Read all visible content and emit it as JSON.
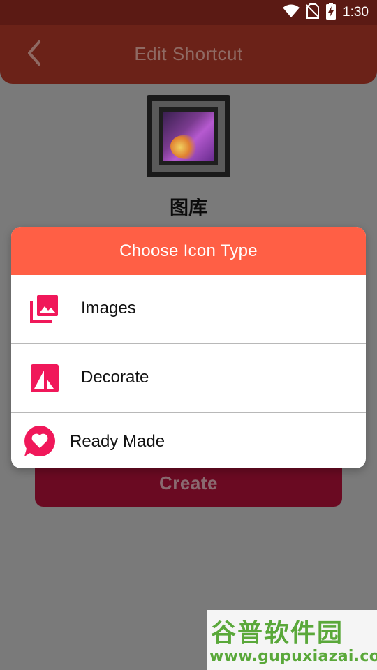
{
  "status_bar": {
    "time": "1:30",
    "icons": [
      "wifi-icon",
      "no-sim-icon",
      "battery-charging-icon"
    ]
  },
  "app_bar": {
    "title": "Edit Shortcut",
    "back_icon": "chevron-left-icon"
  },
  "shortcut": {
    "name": "图库",
    "icon": "gallery-picture-icon"
  },
  "create_button": {
    "label": "Create"
  },
  "dialog": {
    "title": "Choose Icon Type",
    "options": [
      {
        "label": "Images",
        "icon": "photo-library-icon"
      },
      {
        "label": "Decorate",
        "icon": "decorate-icon"
      },
      {
        "label": "Ready Made",
        "icon": "heart-chat-icon"
      }
    ]
  },
  "watermark": {
    "title": "谷普软件园",
    "url": "www.gupuxiazai.com"
  },
  "colors": {
    "status_bar": "#5b1a14",
    "app_bar": "#6b2218",
    "dialog_header": "#ff5f45",
    "icon_accent": "#f0185a",
    "create_button": "#6a0a22",
    "scrim_background": "#7a7a7a",
    "watermark_green": "#5aa83a"
  }
}
